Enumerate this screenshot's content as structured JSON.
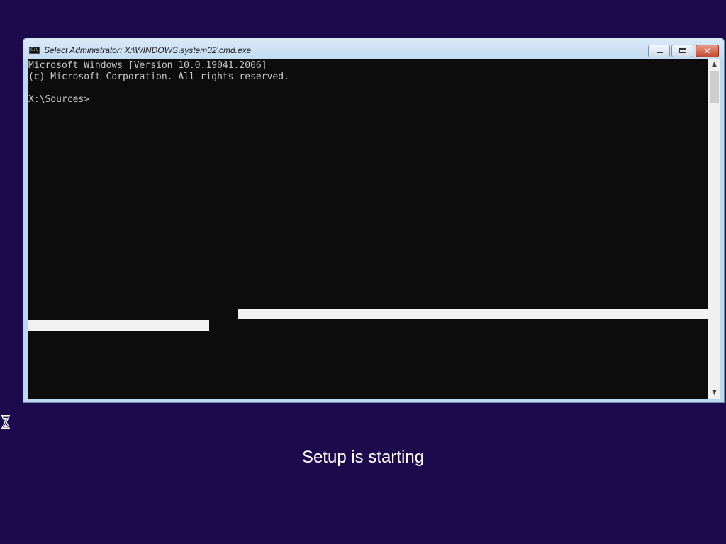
{
  "window": {
    "title": "Select Administrator: X:\\WINDOWS\\system32\\cmd.exe",
    "icon": "cmd-icon",
    "title_icon_text": "C:\\",
    "buttons": {
      "minimize": "minimize-icon",
      "maximize": "maximize-icon",
      "close": "close-icon",
      "close_glyph": "✕"
    }
  },
  "console": {
    "lines": [
      "Microsoft Windows [Version 10.0.19041.2006]",
      "(c) Microsoft Corporation. All rights reserved.",
      "",
      "X:\\Sources>"
    ],
    "background": "#0c0c0c",
    "foreground": "#c8c8c8"
  },
  "scrollbar": {
    "up_arrow": "▲",
    "down_arrow": "▼"
  },
  "status": {
    "message": "Setup is starting",
    "busy_icon": "hourglass-icon"
  },
  "colors": {
    "desktop_background": "#1c0a4c",
    "window_frame": "#bcd7ee",
    "close_button": "#c44a32"
  }
}
